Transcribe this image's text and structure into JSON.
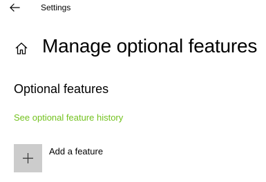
{
  "window": {
    "title": "Settings"
  },
  "header": {
    "title": "Manage optional features",
    "home_icon": "home-icon",
    "back_icon": "arrow-left-icon"
  },
  "section": {
    "heading": "Optional features",
    "history_link": "See optional feature history",
    "add_feature_label": "Add a feature",
    "add_icon": "plus-icon"
  },
  "colors": {
    "accent_link": "#73c21f",
    "add_tile_background": "#cccccc",
    "text": "#000000",
    "background": "#ffffff"
  }
}
